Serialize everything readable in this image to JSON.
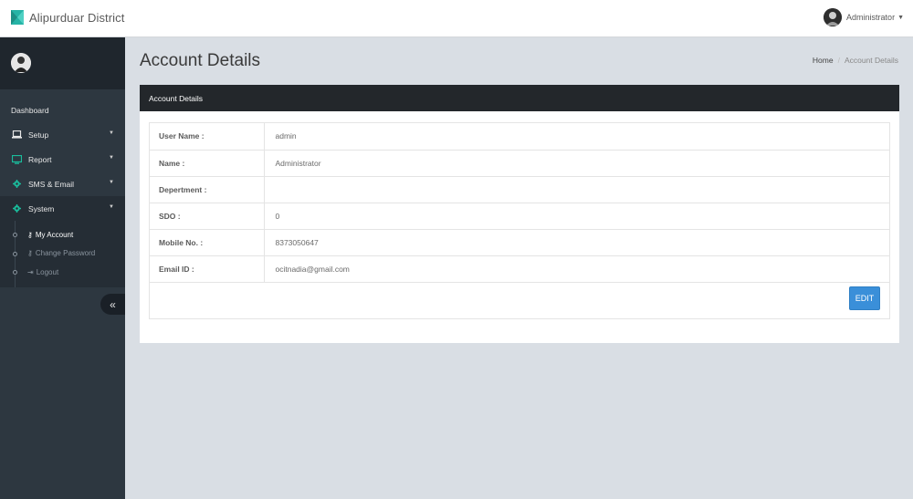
{
  "header": {
    "brand": "Alipurduar District",
    "user": "Administrator"
  },
  "sidebar": {
    "dashboard": "Dashboard",
    "items": [
      {
        "label": "Setup",
        "icon": "laptop-icon"
      },
      {
        "label": "Report",
        "icon": "monitor-icon"
      },
      {
        "label": "SMS & Email",
        "icon": "gear-icon"
      },
      {
        "label": "System",
        "icon": "gear-icon"
      }
    ],
    "submenu": [
      {
        "label": "My Account",
        "icon": "key-icon"
      },
      {
        "label": "Change Password",
        "icon": "key-icon"
      },
      {
        "label": "Logout",
        "icon": "sign-out-icon"
      }
    ],
    "collapse": "«"
  },
  "page": {
    "title": "Account Details",
    "breadcrumb": {
      "home": "Home",
      "sep": "/",
      "current": "Account Details"
    }
  },
  "panel": {
    "title": "Account Details",
    "rows": [
      {
        "label": "User Name :",
        "value": "admin"
      },
      {
        "label": "Name :",
        "value": "Administrator"
      },
      {
        "label": "Depertment :",
        "value": ""
      },
      {
        "label": "SDO :",
        "value": "0"
      },
      {
        "label": "Mobile No. :",
        "value": "8373050647"
      },
      {
        "label": "Email ID :",
        "value": "ocitnadia@gmail.com"
      }
    ],
    "edit_label": "EDIT"
  },
  "colors": {
    "accent": "#3a8fd9",
    "sidebar_bg": "#2d3740",
    "panel_head": "#23272b",
    "icon_green": "#1abc9c"
  }
}
